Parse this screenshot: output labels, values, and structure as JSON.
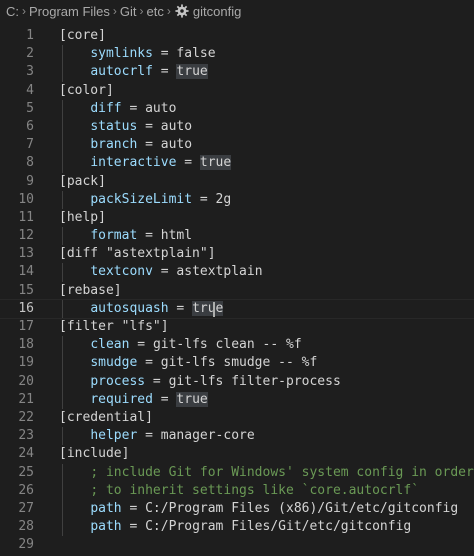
{
  "breadcrumb": {
    "items": [
      "C:",
      "Program Files",
      "Git",
      "etc"
    ],
    "file_label": "gitconfig",
    "file_icon": "gear-icon"
  },
  "editor": {
    "current_line": 16,
    "lines": [
      {
        "n": "1",
        "tokens": [
          [
            "sec",
            "[core]"
          ]
        ]
      },
      {
        "n": "2",
        "tokens": [
          [
            "pad",
            "    "
          ],
          [
            "key",
            "symlinks"
          ],
          [
            "op",
            " = "
          ],
          [
            "val",
            "false"
          ]
        ]
      },
      {
        "n": "3",
        "tokens": [
          [
            "pad",
            "    "
          ],
          [
            "key",
            "autocrlf"
          ],
          [
            "op",
            " = "
          ],
          [
            "true",
            "true"
          ]
        ]
      },
      {
        "n": "4",
        "tokens": [
          [
            "sec",
            "[color]"
          ]
        ]
      },
      {
        "n": "5",
        "tokens": [
          [
            "pad",
            "    "
          ],
          [
            "key",
            "diff"
          ],
          [
            "op",
            " = "
          ],
          [
            "val",
            "auto"
          ]
        ]
      },
      {
        "n": "6",
        "tokens": [
          [
            "pad",
            "    "
          ],
          [
            "key",
            "status"
          ],
          [
            "op",
            " = "
          ],
          [
            "val",
            "auto"
          ]
        ]
      },
      {
        "n": "7",
        "tokens": [
          [
            "pad",
            "    "
          ],
          [
            "key",
            "branch"
          ],
          [
            "op",
            " = "
          ],
          [
            "val",
            "auto"
          ]
        ]
      },
      {
        "n": "8",
        "tokens": [
          [
            "pad",
            "    "
          ],
          [
            "key",
            "interactive"
          ],
          [
            "op",
            " = "
          ],
          [
            "true",
            "true"
          ]
        ]
      },
      {
        "n": "9",
        "tokens": [
          [
            "sec",
            "[pack]"
          ]
        ]
      },
      {
        "n": "10",
        "tokens": [
          [
            "pad",
            "    "
          ],
          [
            "key",
            "packSizeLimit"
          ],
          [
            "op",
            " = "
          ],
          [
            "val",
            "2g"
          ]
        ]
      },
      {
        "n": "11",
        "tokens": [
          [
            "sec",
            "[help]"
          ]
        ]
      },
      {
        "n": "12",
        "tokens": [
          [
            "pad",
            "    "
          ],
          [
            "key",
            "format"
          ],
          [
            "op",
            " = "
          ],
          [
            "val",
            "html"
          ]
        ]
      },
      {
        "n": "13",
        "tokens": [
          [
            "sec",
            "[diff \"astextplain\"]"
          ]
        ]
      },
      {
        "n": "14",
        "tokens": [
          [
            "pad",
            "    "
          ],
          [
            "key",
            "textconv"
          ],
          [
            "op",
            " = "
          ],
          [
            "val",
            "astextplain"
          ]
        ]
      },
      {
        "n": "15",
        "tokens": [
          [
            "sec",
            "[rebase]"
          ]
        ]
      },
      {
        "n": "16",
        "tokens": [
          [
            "pad",
            "    "
          ],
          [
            "key",
            "autosquash"
          ],
          [
            "op",
            " = "
          ],
          [
            "true",
            "true"
          ]
        ]
      },
      {
        "n": "17",
        "tokens": [
          [
            "sec",
            "[filter \"lfs\"]"
          ]
        ]
      },
      {
        "n": "18",
        "tokens": [
          [
            "pad",
            "    "
          ],
          [
            "key",
            "clean"
          ],
          [
            "op",
            " = "
          ],
          [
            "val",
            "git-lfs clean -- %f"
          ]
        ]
      },
      {
        "n": "19",
        "tokens": [
          [
            "pad",
            "    "
          ],
          [
            "key",
            "smudge"
          ],
          [
            "op",
            " = "
          ],
          [
            "val",
            "git-lfs smudge -- %f"
          ]
        ]
      },
      {
        "n": "20",
        "tokens": [
          [
            "pad",
            "    "
          ],
          [
            "key",
            "process"
          ],
          [
            "op",
            " = "
          ],
          [
            "val",
            "git-lfs filter-process"
          ]
        ]
      },
      {
        "n": "21",
        "tokens": [
          [
            "pad",
            "    "
          ],
          [
            "key",
            "required"
          ],
          [
            "op",
            " = "
          ],
          [
            "true",
            "true"
          ]
        ]
      },
      {
        "n": "22",
        "tokens": [
          [
            "sec",
            "[credential]"
          ]
        ]
      },
      {
        "n": "23",
        "tokens": [
          [
            "pad",
            "    "
          ],
          [
            "key",
            "helper"
          ],
          [
            "op",
            " = "
          ],
          [
            "val",
            "manager-core"
          ]
        ]
      },
      {
        "n": "24",
        "tokens": [
          [
            "sec",
            "[include]"
          ]
        ]
      },
      {
        "n": "25",
        "tokens": [
          [
            "pad",
            "    "
          ],
          [
            "cmt",
            "; include Git for Windows' system config in order"
          ]
        ]
      },
      {
        "n": "26",
        "tokens": [
          [
            "pad",
            "    "
          ],
          [
            "cmt",
            "; to inherit settings like `core.autocrlf`"
          ]
        ]
      },
      {
        "n": "27",
        "tokens": [
          [
            "pad",
            "    "
          ],
          [
            "key",
            "path"
          ],
          [
            "op",
            " = "
          ],
          [
            "val",
            "C:/Program Files (x86)/Git/etc/gitconfig"
          ]
        ]
      },
      {
        "n": "28",
        "tokens": [
          [
            "pad",
            "    "
          ],
          [
            "key",
            "path"
          ],
          [
            "op",
            " = "
          ],
          [
            "val",
            "C:/Program Files/Git/etc/gitconfig"
          ]
        ]
      },
      {
        "n": "29",
        "tokens": []
      }
    ]
  },
  "colors": {
    "background": "#1e1e1e",
    "key": "#9cdcfe",
    "comment": "#6a9955",
    "text": "#d4d4d4",
    "line_number": "#858585",
    "highlight": "#3a3d41"
  }
}
